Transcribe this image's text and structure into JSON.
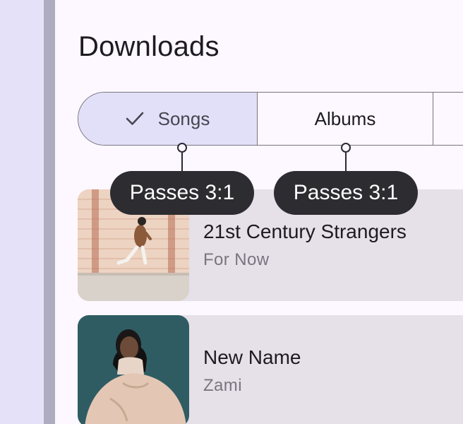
{
  "header": {
    "title": "Downloads"
  },
  "segmented_control": {
    "segments": [
      {
        "label": "Songs",
        "selected": true,
        "icon": "check-icon"
      },
      {
        "label": "Albums",
        "selected": false
      },
      {
        "label": "",
        "selected": false
      }
    ]
  },
  "annotations": [
    {
      "target": "Songs",
      "label": "Passes 3:1"
    },
    {
      "target": "Albums",
      "label": "Passes 3:1"
    }
  ],
  "downloads": [
    {
      "title": "21st Century Strangers",
      "artist": "For Now"
    },
    {
      "title": "New Name",
      "artist": "Zami"
    }
  ],
  "colors": {
    "background": "#fdf7ff",
    "left_pane": "#e4e1f8",
    "divider": "#aeacbf",
    "selected_segment": "#e2e0f9",
    "outline": "#79747e",
    "list_item": "#e6e0e9",
    "annotation_pill": "#2d2c31",
    "text_primary": "#1d1b20",
    "text_secondary": "#79747e"
  }
}
